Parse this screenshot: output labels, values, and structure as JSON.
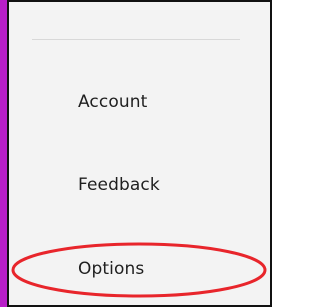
{
  "menu": {
    "items": [
      {
        "label": "Account"
      },
      {
        "label": "Feedback"
      },
      {
        "label": "Options"
      }
    ]
  },
  "annotation": {
    "highlighted_item": "Options",
    "highlight_color": "#e8252b"
  },
  "colors": {
    "accent_strip": "#b81fc8",
    "menu_background": "#f3f3f3",
    "text": "#1f1f1f"
  }
}
